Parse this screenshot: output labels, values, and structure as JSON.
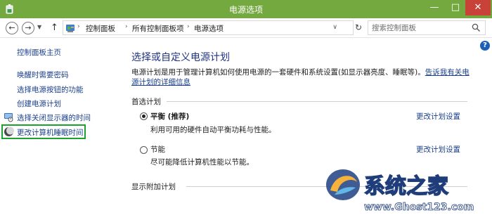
{
  "window": {
    "title": "电源选项",
    "minimize_glyph": "—",
    "maximize_glyph": "□",
    "close_glyph": "✕"
  },
  "address": {
    "back_glyph": "←",
    "forward_glyph": "→",
    "recent_glyph": "▼",
    "up_glyph": "↑",
    "breadcrumbs": [
      "控制面板",
      "所有控制面板项",
      "电源选项"
    ],
    "separator": "›",
    "dropdown_glyph": "∨",
    "refresh_glyph": "↻",
    "search_placeholder": "搜索控制面板"
  },
  "sidebar": {
    "home": "控制面板主页",
    "items": [
      {
        "label": "唤醒时需要密码",
        "icon": "none"
      },
      {
        "label": "选择电源按钮的功能",
        "icon": "none"
      },
      {
        "label": "创建电源计划",
        "icon": "none"
      },
      {
        "label": "选择关闭显示器的时间",
        "icon": "monitor-icon"
      },
      {
        "label": "更改计算机睡眠时间",
        "icon": "moon-icon"
      }
    ],
    "highlight_color": "#1aa32a"
  },
  "help_glyph": "?",
  "main": {
    "title": "选择或自定义电源计划",
    "description": "电源计划是用于管理计算机如何使用电源的一套硬件和系统设置(如显示器亮度、睡眠等)。",
    "description_link": "告诉我有关电源计划的详细信息",
    "preferred_section": "首选计划",
    "plans": [
      {
        "name": "平衡 (推荐)",
        "desc": "利用可用的硬件自动平衡功耗与性能。",
        "link": "更改计划设置",
        "selected": true
      },
      {
        "name": "节能",
        "desc": "尽可能降低计算机性能以节能。",
        "link": "更改计划设置",
        "selected": false
      }
    ],
    "additional_section": "显示附加计划"
  },
  "watermark": {
    "brand": "系统之家",
    "url": "www.Ghost123.com"
  },
  "colors": {
    "titlebar": "#74a93f",
    "link": "#1a3f8b",
    "heading": "#1e3287",
    "close": "#c8423a"
  }
}
